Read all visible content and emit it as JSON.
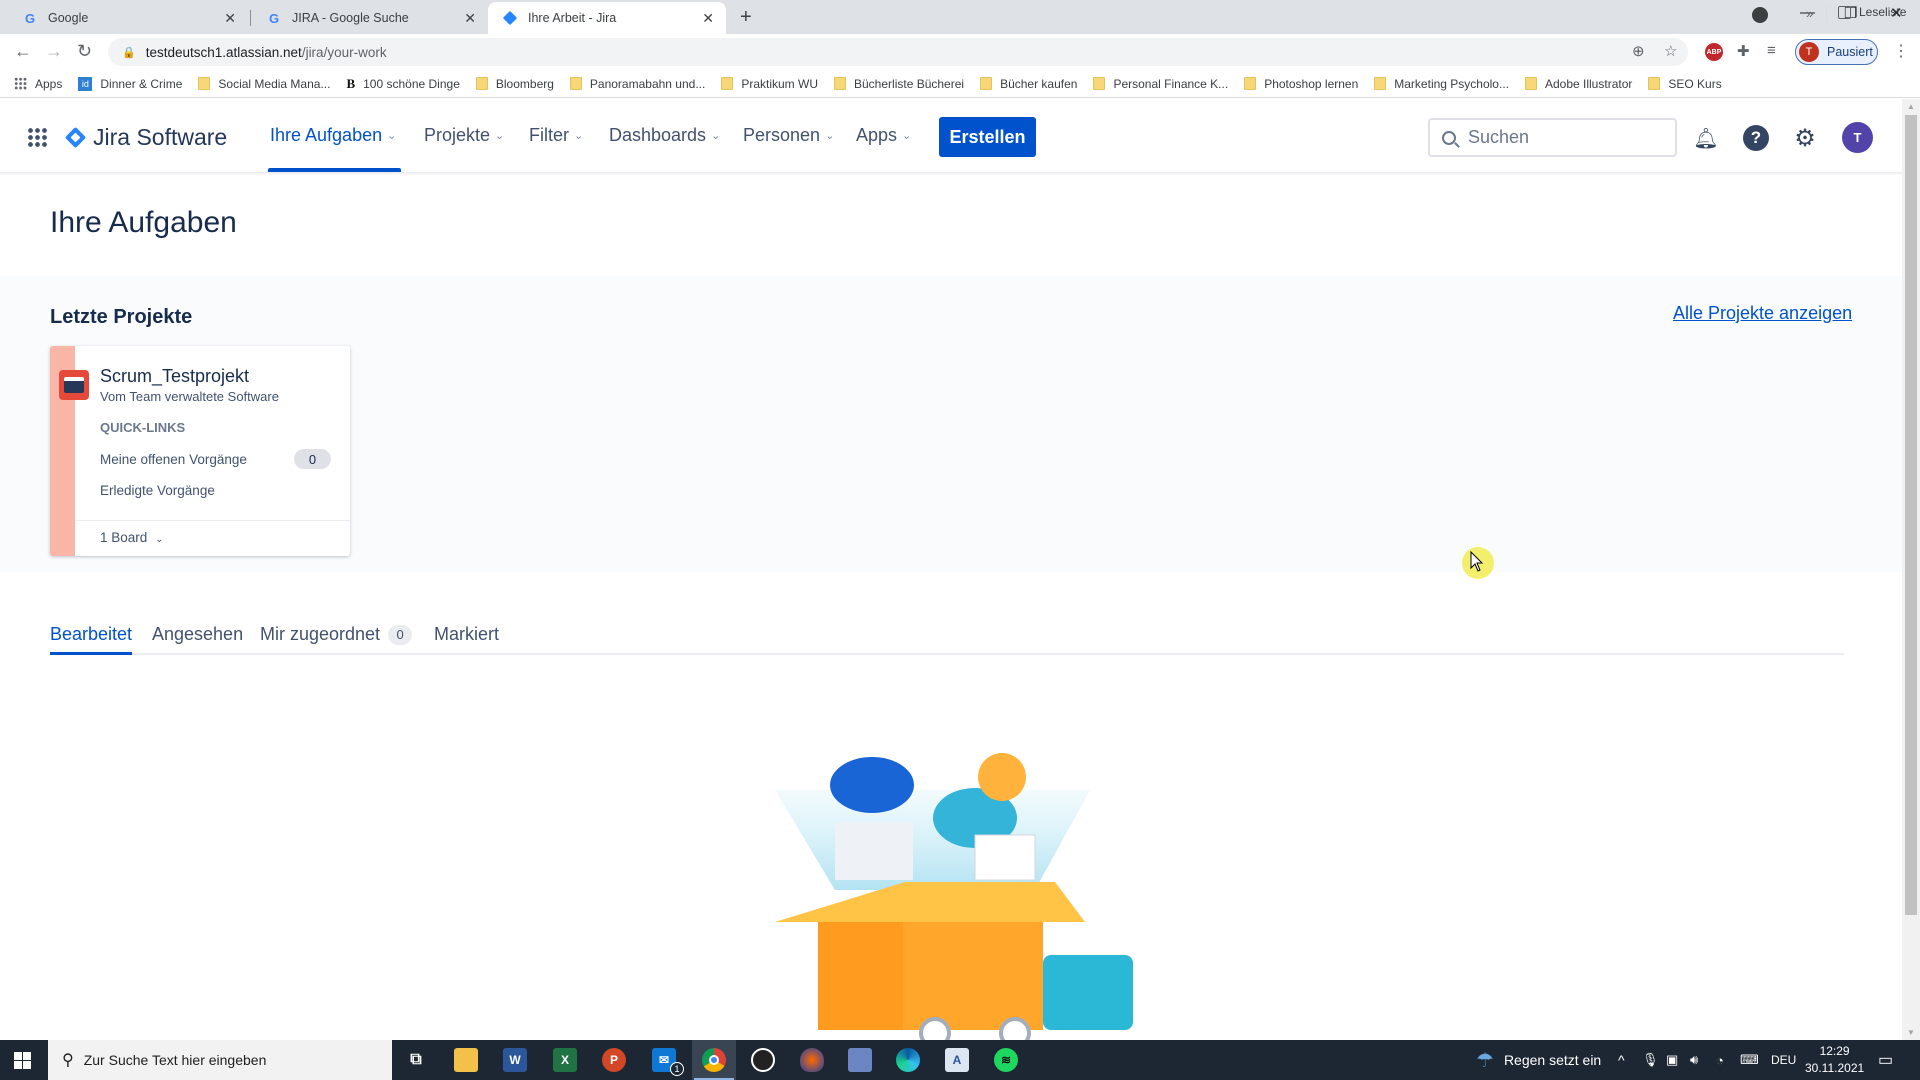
{
  "browser": {
    "tabs": [
      {
        "title": "Google",
        "icon": "google-icon",
        "active": false
      },
      {
        "title": "JIRA - Google Suche",
        "icon": "google-icon",
        "active": false
      },
      {
        "title": "Ihre Arbeit - Jira",
        "icon": "jira-icon",
        "active": true
      }
    ],
    "new_tab": "+",
    "url_host": "testdeutsch1.atlassian.net",
    "url_path": "/jira/your-work",
    "profile_initial": "T",
    "profile_label": "Pausiert",
    "abp_label": "ABP",
    "bookmarks": [
      {
        "label": "Apps",
        "icon": "apps-grid-icon"
      },
      {
        "label": "Dinner & Crime",
        "icon": "id-icon"
      },
      {
        "label": "Social Media Mana...",
        "icon": "folder-icon"
      },
      {
        "label": "100 schöne Dinge",
        "icon": "b-icon"
      },
      {
        "label": "Bloomberg",
        "icon": "folder-icon"
      },
      {
        "label": "Panoramabahn und...",
        "icon": "folder-icon"
      },
      {
        "label": "Praktikum WU",
        "icon": "folder-icon"
      },
      {
        "label": "Bücherliste Bücherei",
        "icon": "folder-icon"
      },
      {
        "label": "Bücher kaufen",
        "icon": "folder-icon"
      },
      {
        "label": "Personal Finance K...",
        "icon": "folder-icon"
      },
      {
        "label": "Photoshop lernen",
        "icon": "folder-icon"
      },
      {
        "label": "Marketing Psycholo...",
        "icon": "folder-icon"
      },
      {
        "label": "Adobe Illustrator",
        "icon": "folder-icon"
      },
      {
        "label": "SEO Kurs",
        "icon": "folder-icon"
      }
    ],
    "bookmarks_more": "»",
    "reading_list": "Leseliste"
  },
  "jira": {
    "product": "Jira Software",
    "nav": [
      {
        "label": "Ihre Aufgaben",
        "active": true
      },
      {
        "label": "Projekte",
        "active": false
      },
      {
        "label": "Filter",
        "active": false
      },
      {
        "label": "Dashboards",
        "active": false
      },
      {
        "label": "Personen",
        "active": false
      },
      {
        "label": "Apps",
        "active": false
      }
    ],
    "create_label": "Erstellen",
    "search_placeholder": "Suchen",
    "avatar_initial": "T",
    "help_glyph": "?"
  },
  "page": {
    "title": "Ihre Aufgaben",
    "recent": {
      "heading": "Letzte Projekte",
      "all_link": "Alle Projekte anzeigen",
      "projects": [
        {
          "name": "Scrum_Testprojekt",
          "type": "Vom Team verwaltete Software",
          "quicklinks_heading": "QUICK-LINKS",
          "quicklinks": [
            {
              "label": "Meine offenen Vorgänge",
              "count": "0"
            },
            {
              "label": "Erledigte Vorgänge"
            }
          ],
          "boards": "1 Board"
        }
      ]
    },
    "tabs": [
      {
        "label": "Bearbeitet",
        "active": true
      },
      {
        "label": "Angesehen",
        "active": false
      },
      {
        "label": "Mir zugeordnet",
        "count": "0",
        "active": false
      },
      {
        "label": "Markiert",
        "active": false
      }
    ]
  },
  "taskbar": {
    "search_placeholder": "Zur Suche Text hier eingeben",
    "apps": [
      "task-view",
      "file-explorer",
      "word",
      "excel",
      "powerpoint",
      "mail",
      "chrome",
      "obs",
      "app-flame",
      "app-paint",
      "edge",
      "notepad",
      "spotify"
    ],
    "mail_badge": "1",
    "weather": "Regen setzt ein",
    "language": "DEU",
    "time": "12:29",
    "date": "30.11.2021"
  },
  "colors": {
    "accent": "#0052cc",
    "project_stripe": "#f9b5a5",
    "avatar": "#5243aa"
  }
}
